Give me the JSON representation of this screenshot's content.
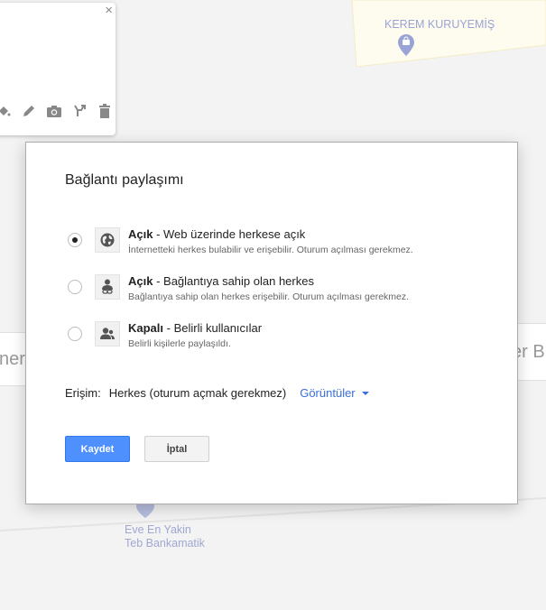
{
  "map": {
    "poi_kerem": "KEREM KURUYEMİŞ",
    "poi_eve_line1": "Eve En Yakin",
    "poi_eve_line2": "Teb Bankamatik",
    "search_left_partial": "ner",
    "search_right_partial": "er B"
  },
  "popup": {
    "close_label": "×",
    "tools": [
      "paint-bucket-icon",
      "pencil-icon",
      "camera-icon",
      "branch-icon",
      "trash-icon"
    ]
  },
  "dialog": {
    "title": "Bağlantı paylaşımı",
    "options": [
      {
        "title": "Açık",
        "desc": " - Web üzerinde herkese açık",
        "sub": "İnternetteki herkes bulabilir ve erişebilir. Oturum açılması gerekmez.",
        "icon": "globe-icon",
        "checked": true
      },
      {
        "title": "Açık",
        "desc": " - Bağlantıya sahip olan herkes",
        "sub": "Bağlantıya sahip olan herkes erişebilir. Oturum açılması gerekmez.",
        "icon": "person-link-icon",
        "checked": false
      },
      {
        "title": "Kapalı",
        "desc": " - Belirli kullanıcılar",
        "sub": "Belirli kişilerle paylaşıldı.",
        "icon": "people-icon",
        "checked": false
      }
    ],
    "access_label": "Erişim:",
    "access_value": "Herkes (oturum açmak gerekmez)",
    "access_permission": "Görüntüler",
    "save_label": "Kaydet",
    "cancel_label": "İptal"
  },
  "colors": {
    "accent": "#4d90fe",
    "link": "#3a6fd8"
  }
}
